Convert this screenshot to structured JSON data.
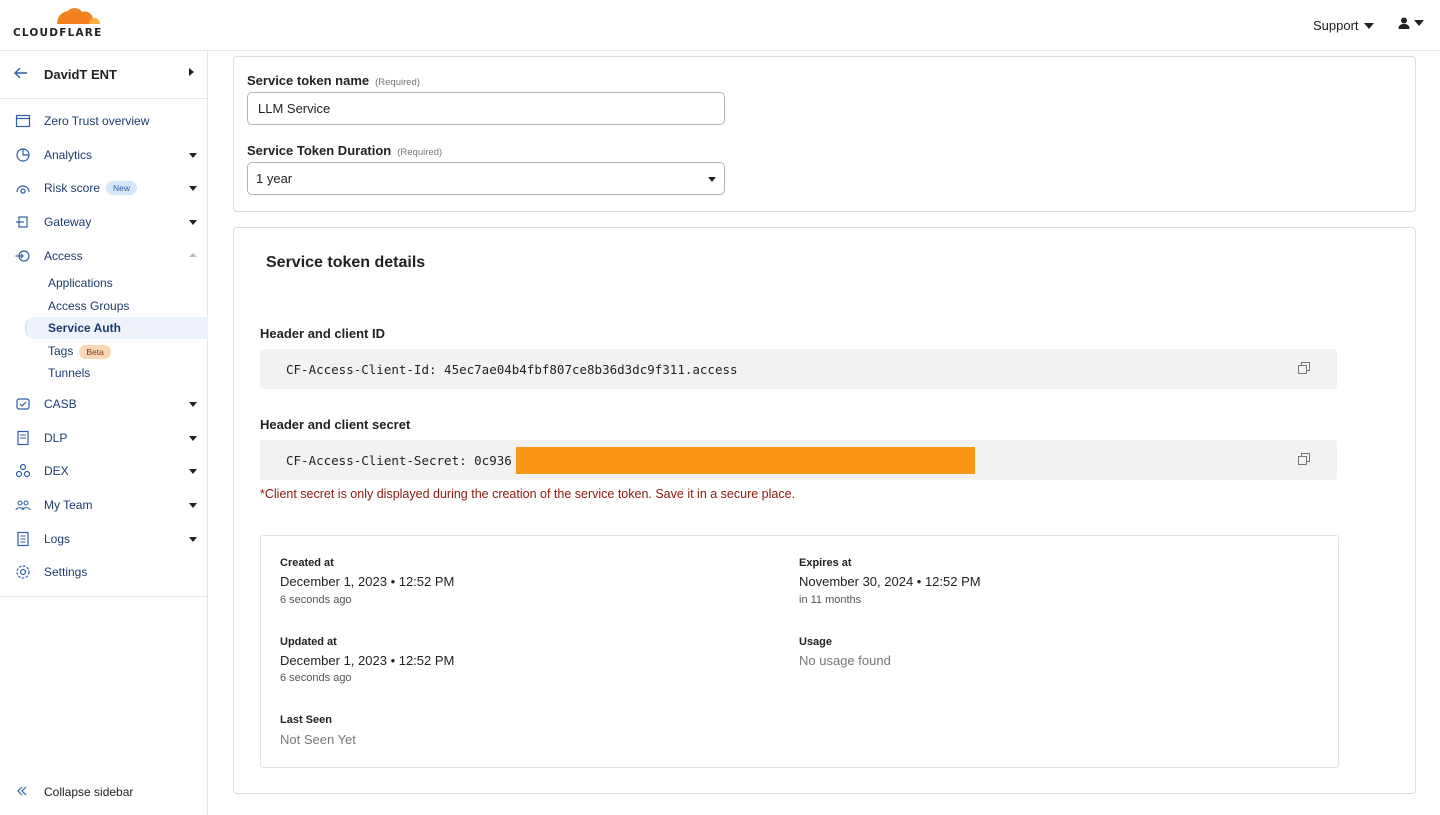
{
  "brand": {
    "logo_text": "CLOUDFLARE",
    "orange": "#F48120",
    "redaction_color": "#FA9515"
  },
  "topbar": {
    "support_label": "Support"
  },
  "sidebar": {
    "account_name": "DavidT ENT",
    "items": [
      {
        "label": "Zero Trust overview",
        "icon": "overview-icon"
      },
      {
        "label": "Analytics",
        "icon": "analytics-icon"
      },
      {
        "label": "Risk score",
        "icon": "risk-score-icon",
        "badge": "New"
      },
      {
        "label": "Gateway",
        "icon": "gateway-icon"
      },
      {
        "label": "Access",
        "icon": "access-icon"
      },
      {
        "label": "CASB",
        "icon": "casb-icon"
      },
      {
        "label": "DLP",
        "icon": "dlp-icon"
      },
      {
        "label": "DEX",
        "icon": "dex-icon"
      },
      {
        "label": "My Team",
        "icon": "team-icon"
      },
      {
        "label": "Logs",
        "icon": "logs-icon"
      },
      {
        "label": "Settings",
        "icon": "settings-icon"
      }
    ],
    "access_sub": [
      {
        "label": "Applications"
      },
      {
        "label": "Access Groups"
      },
      {
        "label": "Service Auth"
      },
      {
        "label": "Tags",
        "badge": "Beta"
      },
      {
        "label": "Tunnels"
      }
    ],
    "collapse_label": "Collapse sidebar"
  },
  "form": {
    "name_label": "Service token name",
    "name_required": "(Required)",
    "name_value": "LLM Service",
    "duration_label": "Service Token Duration",
    "duration_required": "(Required)",
    "duration_value": "1 year"
  },
  "details": {
    "title": "Service token details",
    "client_id_label": "Header and client ID",
    "client_id_value": "CF-Access-Client-Id: 45ec7ae04b4fbf807ce8b36d3dc9f311.access",
    "client_secret_label": "Header and client secret",
    "client_secret_value": "CF-Access-Client-Secret: 0c936",
    "warning": "*Client secret is only displayed during the creation of the service token. Save it in a secure place.",
    "created_label": "Created at",
    "created_value": "December 1, 2023 • 12:52 PM",
    "created_rel": "6 seconds ago",
    "expires_label": "Expires at",
    "expires_value": "November 30, 2024 • 12:52 PM",
    "expires_rel": "in 11 months",
    "updated_label": "Updated at",
    "updated_value": "December 1, 2023 • 12:52 PM",
    "updated_rel": "6 seconds ago",
    "usage_label": "Usage",
    "usage_value": "No usage found",
    "last_seen_label": "Last Seen",
    "last_seen_value": "Not Seen Yet"
  }
}
